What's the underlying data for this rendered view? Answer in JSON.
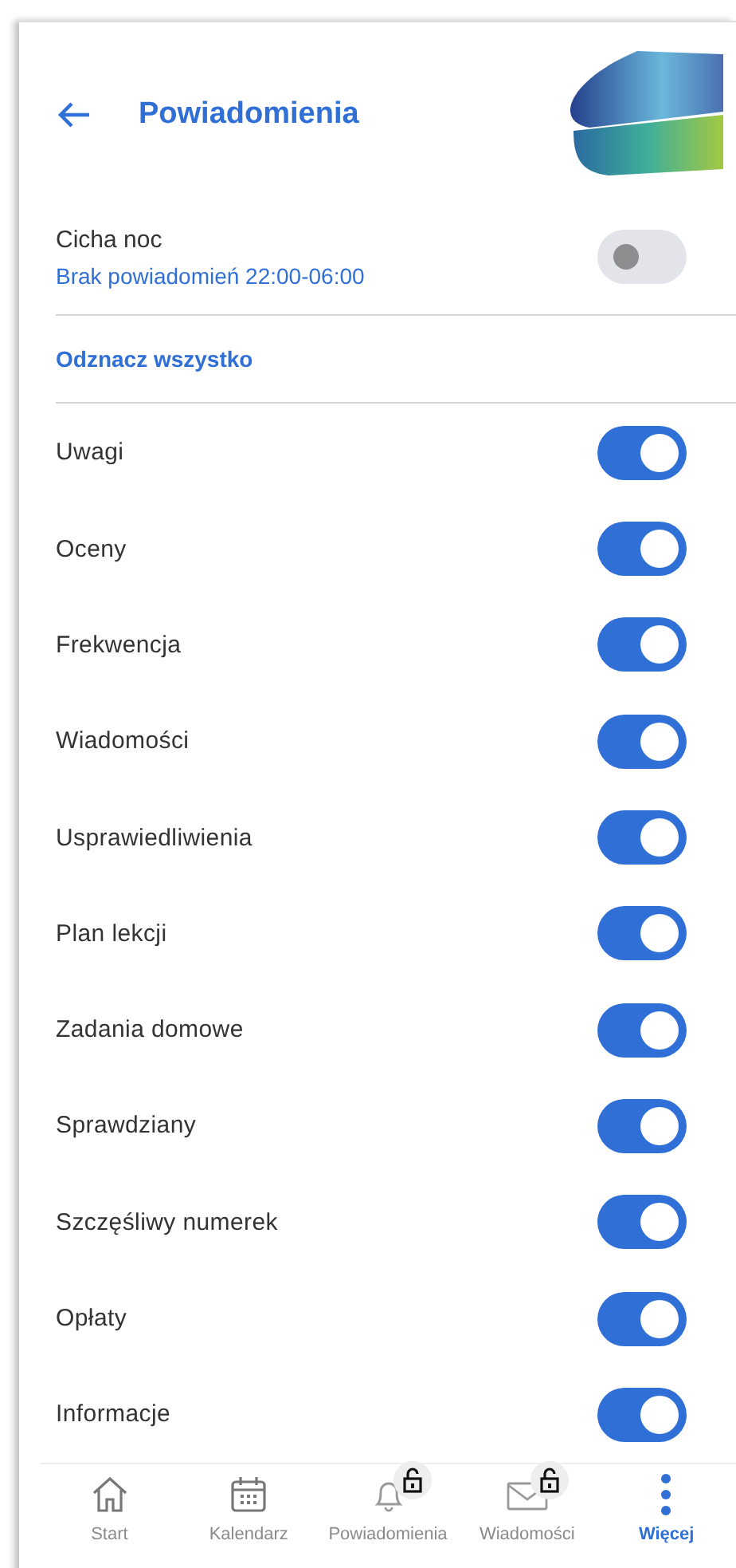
{
  "header": {
    "title": "Powiadomienia"
  },
  "quiet_night": {
    "label": "Cicha noc",
    "subtitle": "Brak powiadomień 22:00-06:00",
    "on": false
  },
  "deselect_all": "Odznacz wszystko",
  "settings": [
    {
      "label": "Uwagi",
      "on": true
    },
    {
      "label": "Oceny",
      "on": true
    },
    {
      "label": "Frekwencja",
      "on": true
    },
    {
      "label": "Wiadomości",
      "on": true
    },
    {
      "label": "Usprawiedliwienia",
      "on": true
    },
    {
      "label": "Plan lekcji",
      "on": true
    },
    {
      "label": "Zadania domowe",
      "on": true
    },
    {
      "label": "Sprawdziany",
      "on": true
    },
    {
      "label": "Szczęśliwy numerek",
      "on": true
    },
    {
      "label": "Opłaty",
      "on": true
    },
    {
      "label": "Informacje",
      "on": true
    }
  ],
  "bottom_nav": [
    {
      "kind": "home",
      "label": "Start",
      "selected": false,
      "locked": false
    },
    {
      "kind": "calendar",
      "label": "Kalendarz",
      "selected": false,
      "locked": false
    },
    {
      "kind": "bell",
      "label": "Powiadomienia",
      "selected": false,
      "locked": true
    },
    {
      "kind": "mail",
      "label": "Wiadomości",
      "selected": false,
      "locked": true
    },
    {
      "kind": "more",
      "label": "Więcej",
      "selected": true,
      "locked": false
    }
  ]
}
